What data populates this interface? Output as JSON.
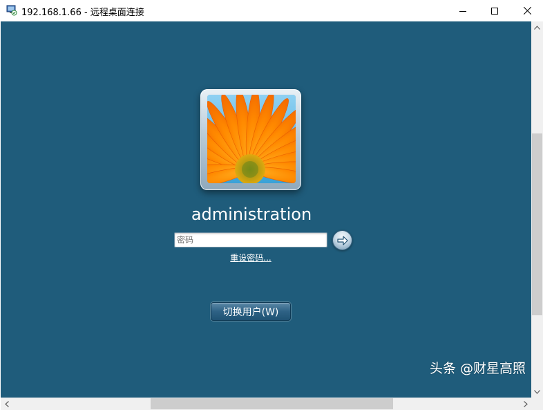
{
  "window": {
    "title": "192.168.1.66 - 远程桌面连接",
    "app_icon": "remote-desktop-icon",
    "controls": {
      "minimize_icon": "minimize-icon",
      "maximize_icon": "maximize-icon",
      "close_icon": "close-icon"
    }
  },
  "logon": {
    "avatar_image": "orange-gerbera-flower",
    "username": "administration",
    "password_placeholder": "密码",
    "password_value": "",
    "submit_icon": "arrow-right-icon",
    "reset_password_link": "重设密码...",
    "switch_user_button": "切换用户(W)"
  },
  "watermark": "头条 @财星高照",
  "colors": {
    "background": "#1f5c7b",
    "titlebar": "#ffffff",
    "text_on_background": "#ffffff"
  }
}
